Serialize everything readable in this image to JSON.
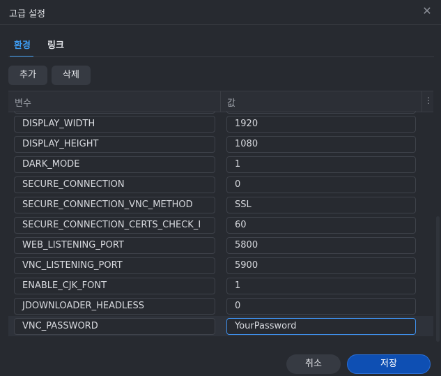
{
  "dialog": {
    "title": "고급 설정",
    "close_icon": "close-icon"
  },
  "tabs": [
    {
      "label": "환경",
      "active": true
    },
    {
      "label": "링크",
      "active": false
    }
  ],
  "toolbar": {
    "add_label": "추가",
    "delete_label": "삭제"
  },
  "table": {
    "columns": [
      "변수",
      "값"
    ],
    "more_icon": "⋮",
    "rows": [
      {
        "key": "DISPLAY_WIDTH",
        "value": "1920"
      },
      {
        "key": "DISPLAY_HEIGHT",
        "value": "1080"
      },
      {
        "key": "DARK_MODE",
        "value": "1"
      },
      {
        "key": "SECURE_CONNECTION",
        "value": "0"
      },
      {
        "key": "SECURE_CONNECTION_VNC_METHOD",
        "value": "SSL"
      },
      {
        "key": "SECURE_CONNECTION_CERTS_CHECK_I",
        "value": "60"
      },
      {
        "key": "WEB_LISTENING_PORT",
        "value": "5800"
      },
      {
        "key": "VNC_LISTENING_PORT",
        "value": "5900"
      },
      {
        "key": "ENABLE_CJK_FONT",
        "value": "1"
      },
      {
        "key": "JDOWNLOADER_HEADLESS",
        "value": "0"
      },
      {
        "key": "VNC_PASSWORD",
        "value": "YourPassword"
      }
    ]
  },
  "footer": {
    "cancel_label": "취소",
    "save_label": "저장"
  },
  "colors": {
    "accent": "#3e9bf0",
    "primary_button": "#0e4fb3",
    "background": "#272a30"
  }
}
